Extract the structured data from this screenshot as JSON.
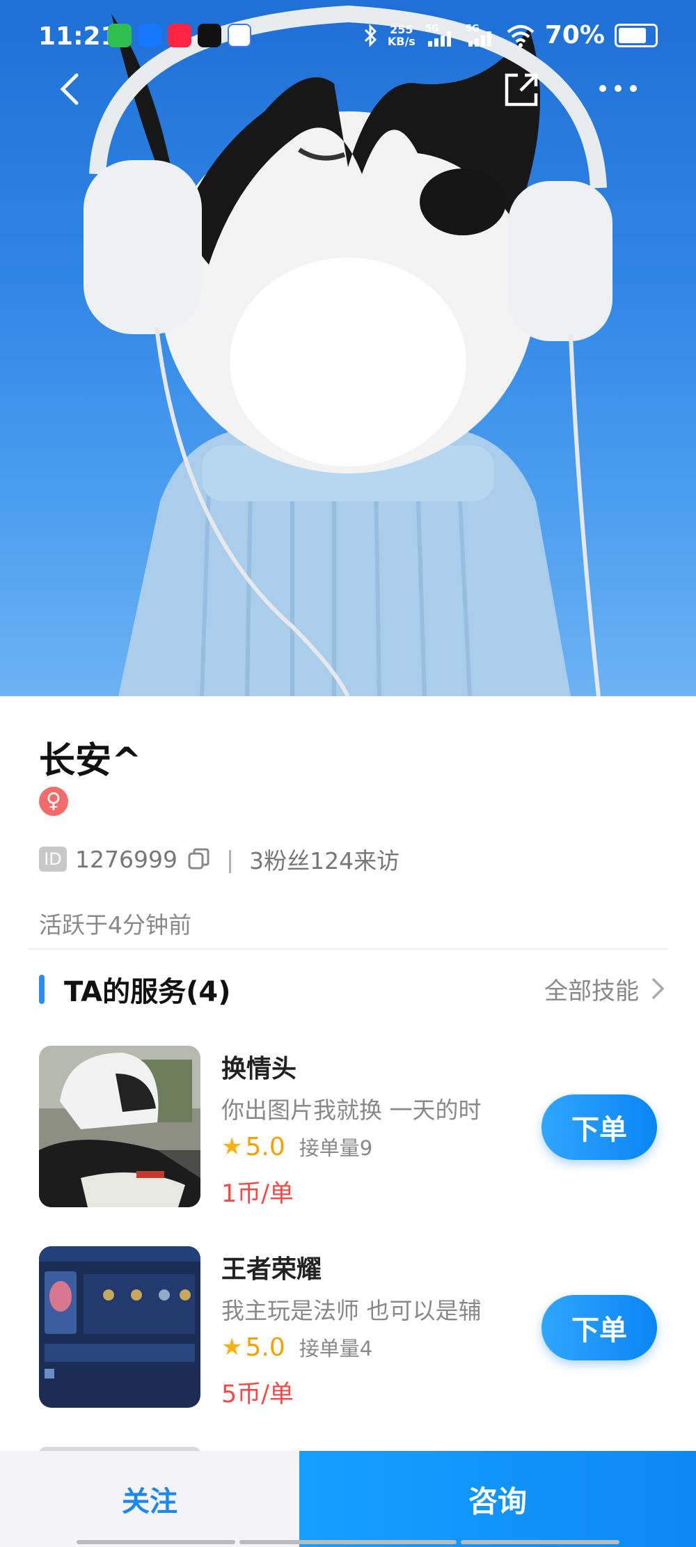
{
  "status_bar": {
    "time": "11:21",
    "net_speed_value": "255",
    "net_speed_unit": "KB/s",
    "battery": "70%",
    "app_icons": [
      "wechat-icon",
      "alipay-icon",
      "xiaohongshu-icon",
      "moji-icon",
      "baidu-icon"
    ]
  },
  "profile": {
    "name": "长安^",
    "gender_symbol": "♀",
    "id_badge": "ID",
    "id": "1276999",
    "separator": "|",
    "stats": "3粉丝124来访",
    "active": "活跃于4分钟前"
  },
  "services": {
    "title": "TA的服务(4)",
    "all_skills": "全部技能",
    "items": [
      {
        "title": "换情头",
        "desc": "你出图片我就换 一天的时",
        "score": "5.0",
        "orders": "接单量9",
        "price": "1币/单",
        "button": "下单"
      },
      {
        "title": "王者荣耀",
        "desc": "我主玩是法师 也可以是辅",
        "score": "5.0",
        "orders": "接单量4",
        "price": "5币/单",
        "button": "下单"
      }
    ]
  },
  "bottom_bar": {
    "follow": "关注",
    "consult": "咨询"
  },
  "colors": {
    "accent": "#1A87F2",
    "price": "#F24A4A",
    "star": "#F7B318"
  }
}
